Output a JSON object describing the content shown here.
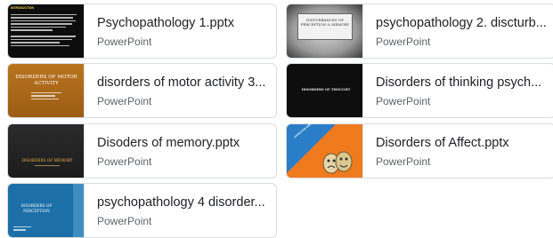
{
  "files": [
    {
      "title": "Psychopathology 1.pptx",
      "type": "PowerPoint",
      "thumb": {
        "heading": "INTRODUCTION"
      }
    },
    {
      "title": "psychopathology 2. discturb...",
      "type": "PowerPoint",
      "thumb": {
        "heading": "DISTURBANCES OF PERCEPTION & MEMORY"
      }
    },
    {
      "title": "disorders of motor activity 3...",
      "type": "PowerPoint",
      "thumb": {
        "heading": "DISORDERS OF MOTOR ACTIVITY"
      }
    },
    {
      "title": "Disorders of thinking psych...",
      "type": "PowerPoint",
      "thumb": {
        "heading": "DISORDERS OF THOUGHT"
      }
    },
    {
      "title": "Disoders of memory.pptx",
      "type": "PowerPoint",
      "thumb": {
        "heading": "DISORDERS OF MEMORY"
      }
    },
    {
      "title": "Disorders of Affect.pptx",
      "type": "PowerPoint",
      "thumb": {
        "heading": "AFFECTIVE DISORDERS"
      }
    },
    {
      "title": "psychopathology 4 disorder...",
      "type": "PowerPoint",
      "thumb": {
        "heading": "DISORDERS OF PERCEPTION"
      }
    }
  ]
}
